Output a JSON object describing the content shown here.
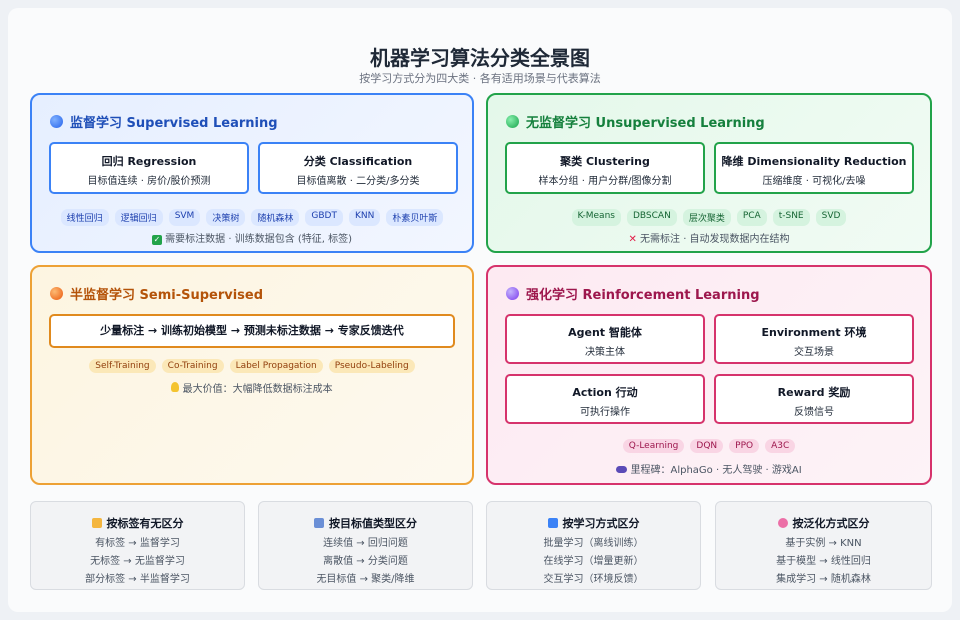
{
  "header": {
    "title": "机器学习算法分类全景图",
    "subtitle": "按学习方式分为四大类 · 各有适用场景与代表算法"
  },
  "supervised": {
    "title": "监督学习 Supervised Learning",
    "boxes": [
      {
        "title": "回归 Regression",
        "desc": "目标值连续 · 房价/股价预测"
      },
      {
        "title": "分类 Classification",
        "desc": "目标值离散 · 二分类/多分类"
      }
    ],
    "tags": [
      "线性回归",
      "逻辑回归",
      "SVM",
      "决策树",
      "随机森林",
      "GBDT",
      "KNN",
      "朴素贝叶斯"
    ],
    "note": "需要标注数据 · 训练数据包含 (特征, 标签)"
  },
  "unsupervised": {
    "title": "无监督学习 Unsupervised Learning",
    "boxes": [
      {
        "title": "聚类 Clustering",
        "desc": "样本分组 · 用户分群/图像分割"
      },
      {
        "title": "降维 Dimensionality Reduction",
        "desc": "压缩维度 · 可视化/去噪"
      }
    ],
    "tags": [
      "K-Means",
      "DBSCAN",
      "层次聚类",
      "PCA",
      "t-SNE",
      "SVD"
    ],
    "note": "无需标注 · 自动发现数据内在结构"
  },
  "semi": {
    "title": "半监督学习 Semi-Supervised",
    "flow": "少量标注 → 训练初始模型 → 预测未标注数据 → 专家反馈迭代",
    "tags": [
      "Self-Training",
      "Co-Training",
      "Label Propagation",
      "Pseudo-Labeling"
    ],
    "note": "最大价值：大幅降低数据标注成本"
  },
  "rl": {
    "title": "强化学习 Reinforcement Learning",
    "boxes": [
      {
        "title": "Agent 智能体",
        "desc": "决策主体"
      },
      {
        "title": "Environment 环境",
        "desc": "交互场景"
      },
      {
        "title": "Action 行动",
        "desc": "可执行操作"
      },
      {
        "title": "Reward 奖励",
        "desc": "反馈信号"
      }
    ],
    "tags": [
      "Q-Learning",
      "DQN",
      "PPO",
      "A3C"
    ],
    "note": "里程碑：AlphaGo · 无人驾驶 · 游戏AI"
  },
  "cards": [
    {
      "icon": "tag-icon",
      "color": "#f4b63f",
      "title": "按标签有无区分",
      "lines": [
        "有标签 → 监督学习",
        "无标签 → 无监督学习",
        "部分标签 → 半监督学习"
      ]
    },
    {
      "icon": "bar-chart-icon",
      "color": "#6b8fd6",
      "title": "按目标值类型区分",
      "lines": [
        "连续值 → 回归问题",
        "离散值 → 分类问题",
        "无目标值 → 聚类/降维"
      ]
    },
    {
      "icon": "refresh-icon",
      "color": "#3b82f6",
      "title": "按学习方式区分",
      "lines": [
        "批量学习（离线训练）",
        "在线学习（增量更新）",
        "交互学习（环境反馈）"
      ]
    },
    {
      "icon": "brain-icon",
      "color": "#ec6fa7",
      "title": "按泛化方式区分",
      "lines": [
        "基于实例 → KNN",
        "基于模型 → 线性回归",
        "集成学习 → 随机森林"
      ]
    }
  ]
}
